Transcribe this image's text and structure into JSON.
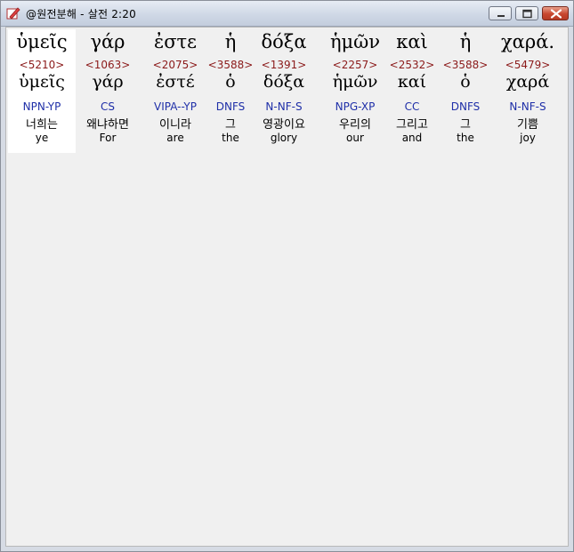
{
  "window": {
    "title": "@원전분해 - 살전 2:20"
  },
  "words": [
    {
      "greek": "ὑμεῖς",
      "strong": "<5210>",
      "lemma": "ὑμεῖς",
      "parse": "NPN-YP",
      "korean": "너희는",
      "english": "ye"
    },
    {
      "greek": "γάρ",
      "strong": "<1063>",
      "lemma": "γάρ",
      "parse": "CS",
      "korean": "왜냐하면",
      "english": "For"
    },
    {
      "greek": "ἐστε",
      "strong": "<2075>",
      "lemma": "ἐστέ",
      "parse": "VIPA--YP",
      "korean": "이니라",
      "english": "are"
    },
    {
      "greek": "ἡ",
      "strong": "<3588>",
      "lemma": "ὁ",
      "parse": "DNFS",
      "korean": "그",
      "english": "the"
    },
    {
      "greek": "δόξα",
      "strong": "<1391>",
      "lemma": "δόξα",
      "parse": "N-NF-S",
      "korean": "영광이요",
      "english": "glory"
    },
    {
      "greek": "ἡμῶν",
      "strong": "<2257>",
      "lemma": "ἡμῶν",
      "parse": "NPG-XP",
      "korean": "우리의",
      "english": "our"
    },
    {
      "greek": "καὶ",
      "strong": "<2532>",
      "lemma": "καί",
      "parse": "CC",
      "korean": "그리고",
      "english": "and"
    },
    {
      "greek": "ἡ",
      "strong": "<3588>",
      "lemma": "ὁ",
      "parse": "DNFS",
      "korean": "그",
      "english": "the"
    },
    {
      "greek": "χαρά.",
      "strong": "<5479>",
      "lemma": "χαρά",
      "parse": "N-NF-S",
      "korean": "기쁨",
      "english": "joy"
    }
  ],
  "colors": {
    "strong": "#8b1a1a",
    "parse": "#1f2fa8",
    "selected_column": "#ffffff"
  }
}
